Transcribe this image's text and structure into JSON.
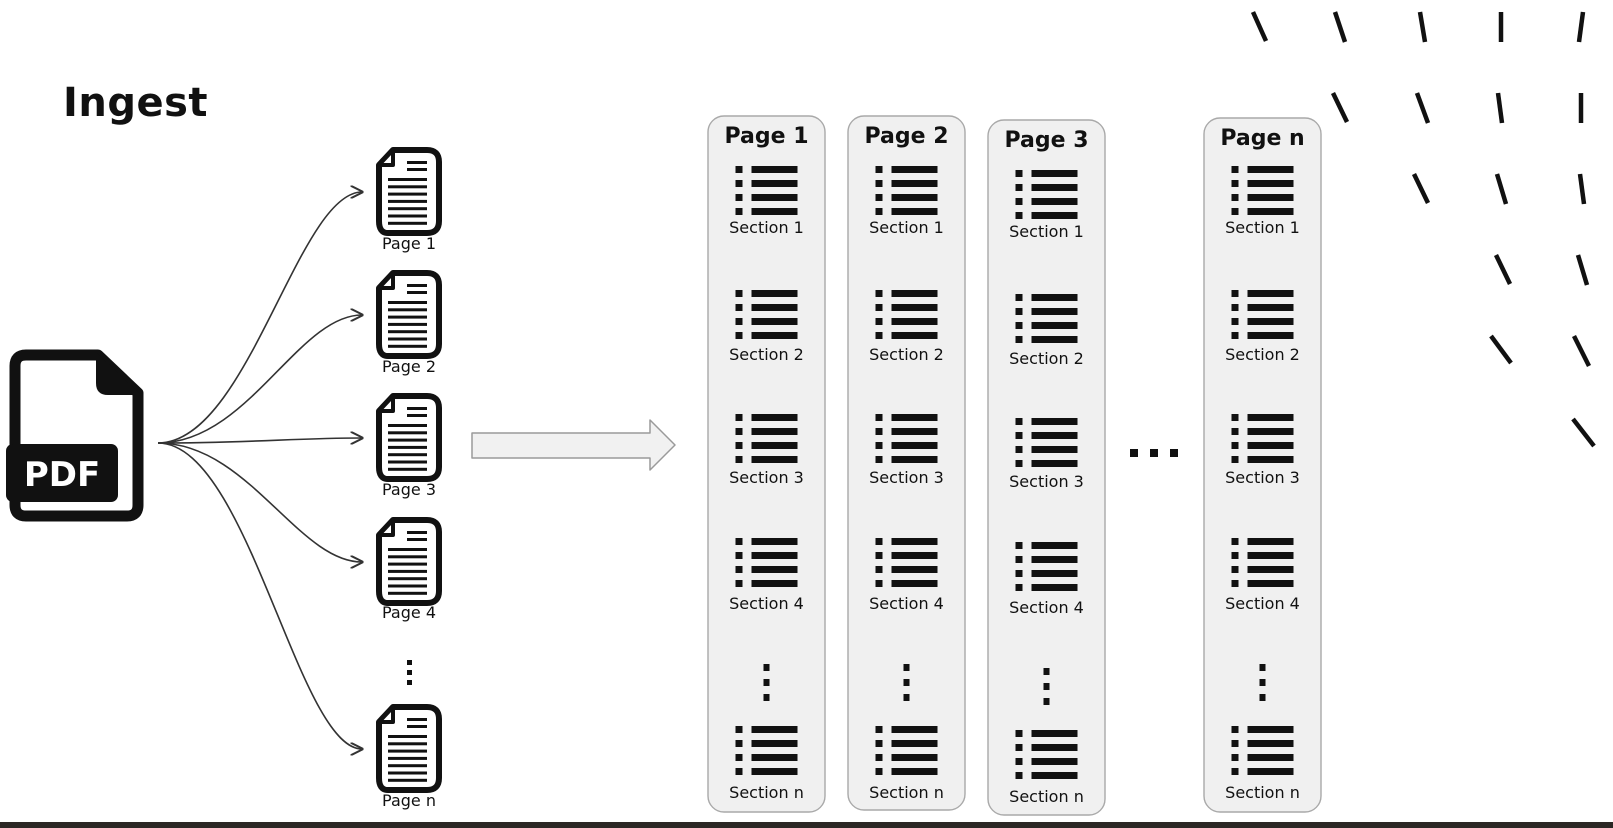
{
  "title": "Ingest",
  "source": {
    "icon": "pdf-file-icon",
    "label": "PDF"
  },
  "split_pages": [
    {
      "label": "Page 1",
      "icon": "document-icon"
    },
    {
      "label": "Page 2",
      "icon": "document-icon"
    },
    {
      "label": "Page 3",
      "icon": "document-icon"
    },
    {
      "label": "Page 4",
      "icon": "document-icon"
    },
    {
      "label": "Page n",
      "icon": "document-icon"
    }
  ],
  "split_ellipsis": "vertical-ellipsis",
  "transition_arrow": "block-arrow-right",
  "page_columns": [
    {
      "title": "Page 1",
      "sections": [
        "Section 1",
        "Section 2",
        "Section 3",
        "Section 4",
        "Section n"
      ]
    },
    {
      "title": "Page 2",
      "sections": [
        "Section 1",
        "Section 2",
        "Section 3",
        "Section 4",
        "Section n"
      ]
    },
    {
      "title": "Page 3",
      "sections": [
        "Section 1",
        "Section 2",
        "Section 3",
        "Section 4",
        "Section n"
      ]
    },
    {
      "title": "Page n",
      "sections": [
        "Section 1",
        "Section 2",
        "Section 3",
        "Section 4",
        "Section n"
      ]
    }
  ],
  "section_icon": "list-icon",
  "columns_ellipsis": "horizontal-ellipsis",
  "colors": {
    "ink": "#111111",
    "panel_fill": "#f0f0f0",
    "panel_stroke": "#a9a9a9",
    "arrow_fill": "#f1f1f1",
    "arrow_stroke": "#9a9a9a",
    "bottom_bar": "#2b2724"
  }
}
